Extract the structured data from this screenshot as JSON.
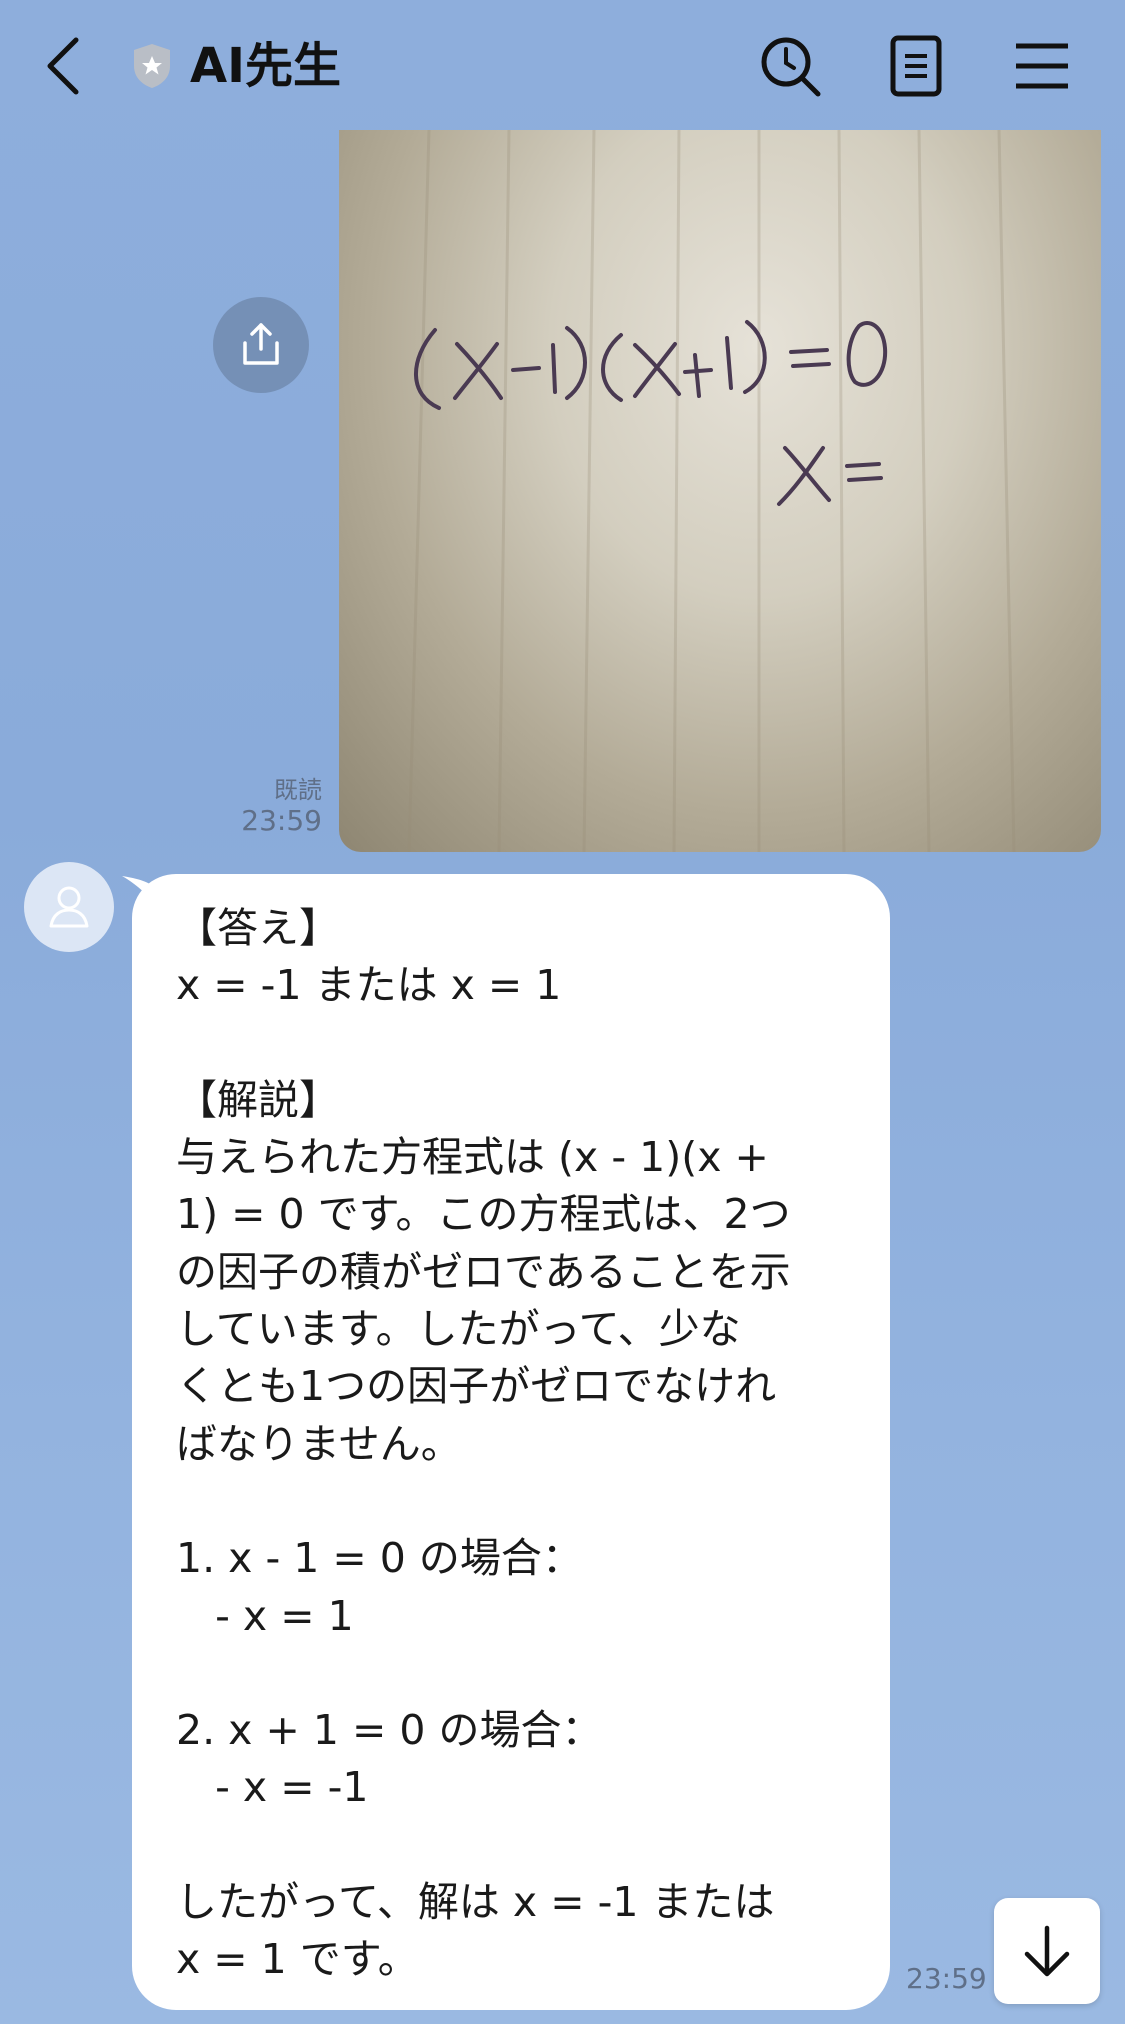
{
  "header": {
    "title": "AI先生",
    "back_icon": "chevron-left-icon",
    "official_badge_icon": "shield-star-icon",
    "buttons": [
      "search-icon",
      "notes-icon",
      "menu-icon"
    ]
  },
  "messages": {
    "sent_photo": {
      "handwriting_line1": "(x-1)(x+1) = 0",
      "handwriting_line2": "x =",
      "read_label": "既読",
      "time": "23:59"
    },
    "reply": {
      "text": "【答え】\nx = -1 または x = 1\n\n【解説】\n与えられた方程式は (x - 1)(x +\n1) = 0 です。この方程式は、2つ\nの因子の積がゼロであることを示\nしています。したがって、少な\nくとも1つの因子がゼロでなけれ\nばなりません。\n\n1. x - 1 = 0 の場合：\n   - x = 1\n\n2. x + 1 = 0 の場合：\n   - x = -1\n\nしたがって、解は x = -1 または\nx = 1 です。",
      "time": "23:59"
    }
  },
  "colors": {
    "background": "#8eaedc",
    "bubble": "#ffffff",
    "text": "#1a1a1a",
    "meta_text": "#5f6f88"
  }
}
